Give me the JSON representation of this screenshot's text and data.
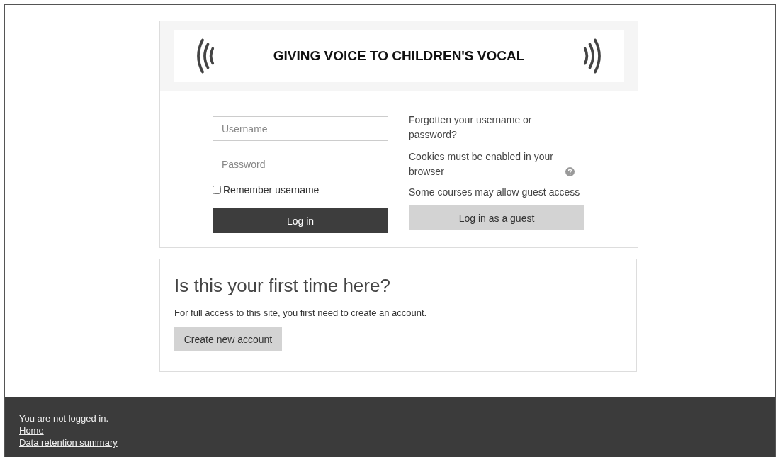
{
  "banner": {
    "title": "GIVING VOICE TO CHILDREN'S VOCAL"
  },
  "login": {
    "username": {
      "placeholder": "Username"
    },
    "password": {
      "placeholder": "Password"
    },
    "remember": {
      "label": "Remember username",
      "checked": false
    },
    "login_button": "Log in",
    "forgot_link": "Forgotten your username or password?",
    "cookies_note": "Cookies must be enabled in your browser",
    "guest_note": "Some courses may allow guest access",
    "guest_button": "Log in as a guest"
  },
  "signup": {
    "heading": "Is this your first time here?",
    "text": "For full access to this site, you first need to create an account.",
    "button": "Create new account"
  },
  "footer": {
    "status": "You are not logged in.",
    "links": [
      "Home",
      "Data retention summary"
    ]
  }
}
